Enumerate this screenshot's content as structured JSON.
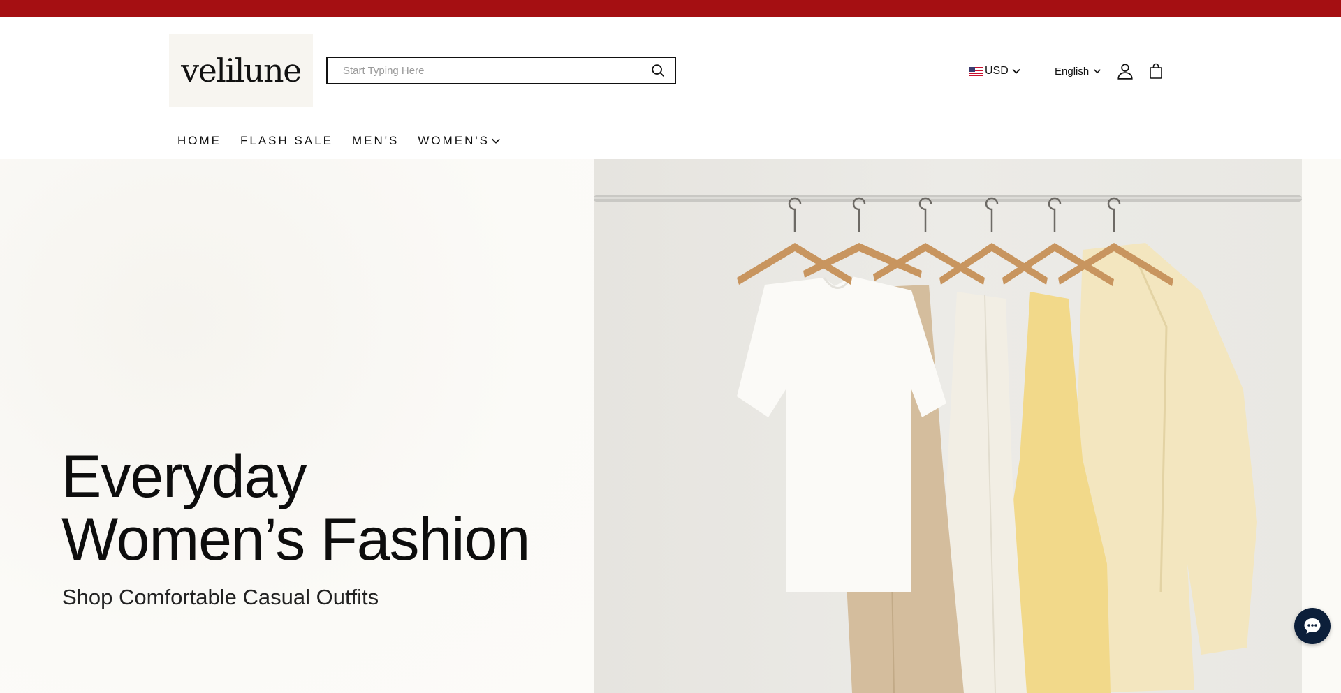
{
  "brand": {
    "logo_text": "velilune"
  },
  "colors": {
    "promo_bar": "#a50f12",
    "text": "#111111",
    "chat_button": "#0c1f3a"
  },
  "search": {
    "placeholder": "Start Typing Here",
    "icon": "search-icon"
  },
  "header": {
    "currency": {
      "label": "USD",
      "flag_icon": "us-flag-icon"
    },
    "language": {
      "label": "English"
    },
    "account_icon": "user-icon",
    "cart_icon": "shopping-bag-icon"
  },
  "nav": {
    "items": [
      {
        "label": "HOME"
      },
      {
        "label": "FLASH SALE"
      },
      {
        "label": "MEN'S"
      },
      {
        "label": "WOMEN'S",
        "has_dropdown": true
      }
    ]
  },
  "hero": {
    "title_line1": "Everyday",
    "title_line2": "Women’s Fashion",
    "subtitle": "Shop Comfortable Casual Outfits"
  },
  "chat": {
    "icon": "chat-bubble-icon"
  }
}
